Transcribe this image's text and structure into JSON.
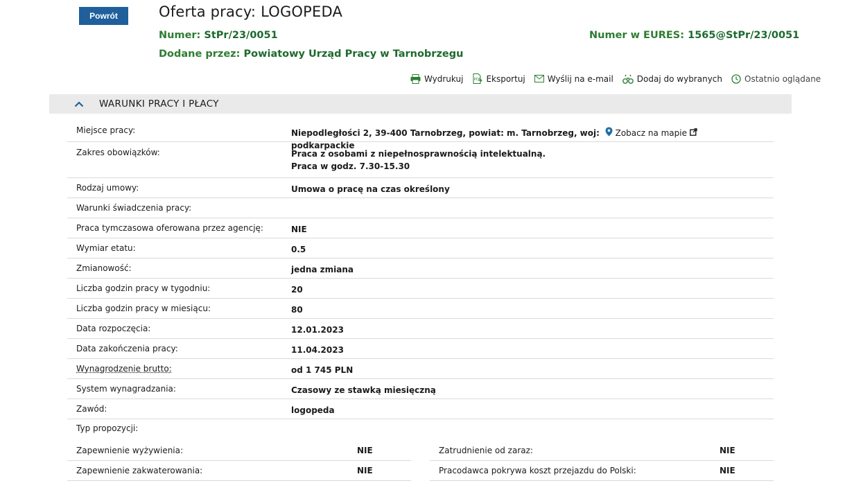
{
  "header": {
    "back_label": "Powrót",
    "title": "Oferta pracy: LOGOPEDA",
    "number_label": "Numer:",
    "number_value": "StPr/23/0051",
    "eures_label": "Numer w EURES:",
    "eures_value": "1565@StPr/23/0051",
    "added_label": "Dodane przez:",
    "added_value": "Powiatowy Urząd Pracy w Tarnobrzegu"
  },
  "actions": {
    "print": "Wydrukuj",
    "export": "Eksportuj",
    "email": "Wyślij na e-mail",
    "favorites": "Dodaj do wybranych",
    "recent": "Ostatnio oglądane"
  },
  "section": {
    "title": "WARUNKI PRACY I PŁACY"
  },
  "rows": [
    {
      "label": "Miejsce pracy:",
      "value": "Niepodległości 2, 39-400 Tarnobrzeg, powiat: m. Tarnobrzeg, woj: podkarpackie",
      "map_link": "Zobacz na mapie"
    },
    {
      "label": "Zakres obowiązków:",
      "value": "Praca z osobami z niepełnosprawnością intelektualną.",
      "value2": "Praca w godz. 7.30-15.30"
    },
    {
      "label": "Rodzaj umowy:",
      "value": "Umowa o pracę na czas określony"
    },
    {
      "label": "Warunki świadczenia pracy:",
      "value": ""
    },
    {
      "label": "Praca tymczasowa oferowana przez agencję:",
      "value": "NIE"
    },
    {
      "label": "Wymiar etatu:",
      "value": "0.5"
    },
    {
      "label": "Zmianowość:",
      "value": "jedna zmiana"
    },
    {
      "label": "Liczba godzin pracy w tygodniu:",
      "value": "20"
    },
    {
      "label": "Liczba godzin pracy w miesiącu:",
      "value": "80"
    },
    {
      "label": "Data rozpoczęcia:",
      "value": "12.01.2023"
    },
    {
      "label": "Data zakończenia pracy:",
      "value": "11.04.2023"
    },
    {
      "label": "Wynagrodzenie brutto:",
      "value": "od 1 745 PLN"
    },
    {
      "label": "System wynagradzania:",
      "value": "Czasowy ze stawką miesięczną"
    },
    {
      "label": "Zawód:",
      "value": "logopeda"
    },
    {
      "label": "Typ propozycji:",
      "value": ""
    }
  ],
  "extras": {
    "left": [
      {
        "label": "Zapewnienie wyżywienia:",
        "value": "NIE"
      },
      {
        "label": "Zapewnienie zakwaterowania:",
        "value": "NIE"
      }
    ],
    "right": [
      {
        "label": "Zatrudnienie od zaraz:",
        "value": "NIE"
      },
      {
        "label": "Pracodawca pokrywa koszt przejazdu do Polski:",
        "value": "NIE"
      }
    ]
  },
  "colors": {
    "primary_button": "#1f5f9b",
    "accent_green": "#1d6a2e",
    "section_bg": "#eaeaea"
  }
}
